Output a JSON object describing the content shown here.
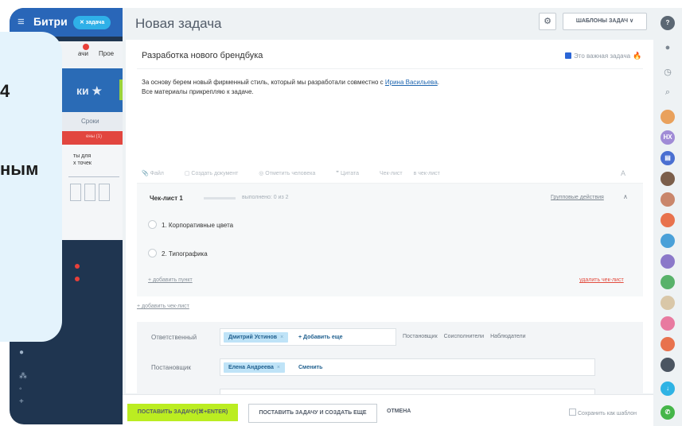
{
  "left_app": {
    "brand": "Битри",
    "task_chip": "✕ задача",
    "tabs_fragment": [
      "ачи",
      "Прое"
    ],
    "header_fragment": "ки ★",
    "tab_fragment": "Сроки",
    "red_fragment": "ены (1)",
    "card_text": "ты для\nх точек"
  },
  "overlay": {
    "number": "4",
    "word": "ным"
  },
  "header": {
    "title": "Новая задача",
    "templates_label": "ШАБЛОНЫ ЗАДАЧ ∨"
  },
  "task": {
    "title": "Разработка нового брендбука",
    "important_label": "Это важная задача",
    "description_line1_before": "За основу берем новый фирменный стиль, который мы разработали совместно с ",
    "description_link": "Ирина Васильева",
    "description_line1_after": ".",
    "description_line2": "Все материалы прикрепляю к задаче."
  },
  "toolbar": {
    "items": [
      "Файл",
      "Создать документ",
      "Отметить человека",
      "Цитата",
      "Чек-лист",
      "в чек-лист"
    ],
    "font_label": "A"
  },
  "checklist": {
    "title": "Чек-лист 1",
    "progress": "выполнено: 0 из 2",
    "group_actions": "Групповые действия",
    "items": [
      "1. Корпоративные цвета",
      "2. Типографика"
    ],
    "add_item": "+ добавить пункт",
    "delete": "удалить чек-лист"
  },
  "add_checklist": "+ добавить чек-лист",
  "people": {
    "responsible_label": "Ответственный",
    "responsible_tag": "Дмитрий Устинов",
    "add_more": "+ Добавить еще",
    "roles": [
      "Постановщик",
      "Соисполнители",
      "Наблюдатели"
    ],
    "creator_label": "Постановщик",
    "creator_tag": "Елена Андреева",
    "change": "Сменить"
  },
  "footer": {
    "primary": "ПОСТАВИТЬ ЗАДАЧУ(⌘+ENTER)",
    "secondary": "ПОСТАВИТЬ ЗАДАЧУ И СОЗДАТЬ ЕЩЕ",
    "cancel": "ОТМЕНА",
    "save_template": "Сохранить как шаблон"
  },
  "rail": {
    "initials": "НХ"
  },
  "colors": {
    "accent_green": "#bbed21",
    "link_blue": "#2067b0",
    "tag_blue": "#bfe3f7",
    "danger_red": "#e24c3f"
  }
}
